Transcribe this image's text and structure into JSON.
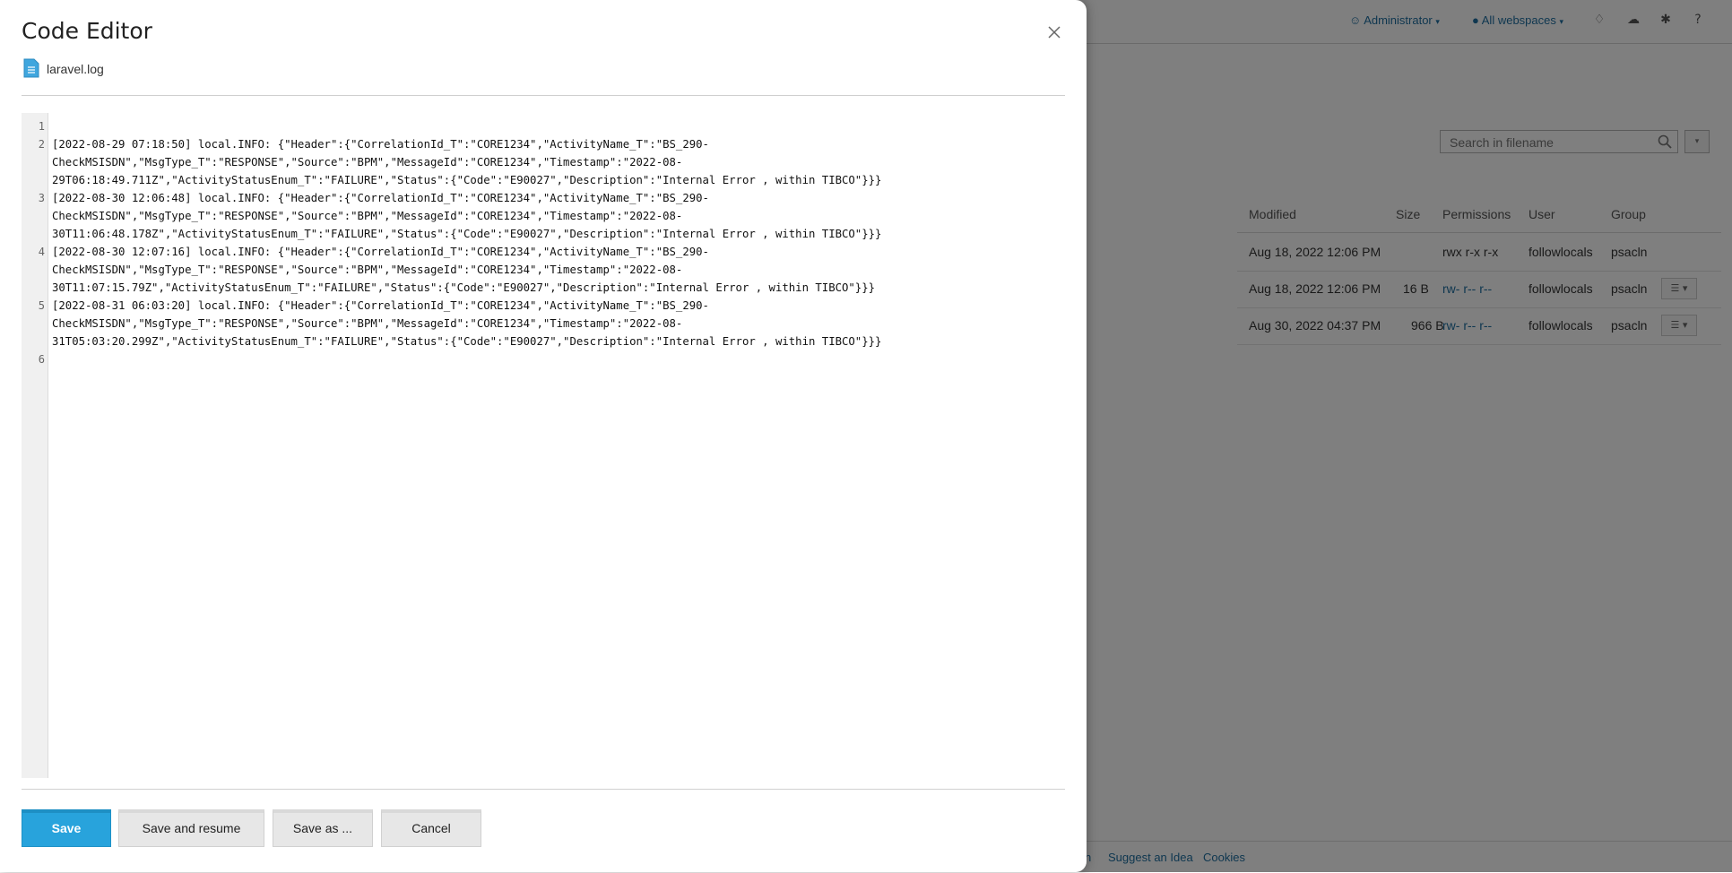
{
  "background": {
    "topbar": {
      "user_label": "Administrator",
      "webspaces_label": "All webspaces",
      "icons": [
        "bell-icon",
        "cloud-icon",
        "puzzle-icon",
        "help-icon"
      ]
    },
    "search": {
      "placeholder": "Search in filename"
    },
    "table": {
      "columns": [
        "Modified",
        "Size",
        "Permissions",
        "User",
        "Group"
      ],
      "rows": [
        {
          "modified": "Aug 18, 2022 12:06 PM",
          "size": "",
          "permissions": "rwx r-x r-x",
          "user": "followlocals",
          "group": "psacln"
        },
        {
          "modified": "Aug 18, 2022 12:06 PM",
          "size": "16 B",
          "permissions": "rw- r-- r--",
          "user": "followlocals",
          "group": "psacln"
        },
        {
          "modified": "Aug 30, 2022 04:37 PM",
          "size": "966 B",
          "permissions": "rw- r-- r--",
          "user": "followlocals",
          "group": "psacln"
        }
      ]
    },
    "footer": {
      "links": [
        "n",
        "Suggest an Idea",
        "Cookies"
      ]
    }
  },
  "modal": {
    "title": "Code Editor",
    "file_name": "laravel.log",
    "editor": {
      "line_numbers": [
        "1",
        "2",
        "3",
        "4",
        "5",
        "6"
      ],
      "wrapped_lines": [
        "[2022-08-29 07:18:50] local.INFO: {\"Header\":{\"CorrelationId_T\":\"CORE1234\",\"ActivityName_T\":\"BS_290-",
        "CheckMSISDN\",\"MsgType_T\":\"RESPONSE\",\"Source\":\"BPM\",\"MessageId\":\"CORE1234\",\"Timestamp\":\"2022-08-",
        "29T06:18:49.711Z\",\"ActivityStatusEnum_T\":\"FAILURE\",\"Status\":{\"Code\":\"E90027\",\"Description\":\"Internal Error , within TIBCO\"}}}",
        "[2022-08-30 12:06:48] local.INFO: {\"Header\":{\"CorrelationId_T\":\"CORE1234\",\"ActivityName_T\":\"BS_290-",
        "CheckMSISDN\",\"MsgType_T\":\"RESPONSE\",\"Source\":\"BPM\",\"MessageId\":\"CORE1234\",\"Timestamp\":\"2022-08-",
        "30T11:06:48.178Z\",\"ActivityStatusEnum_T\":\"FAILURE\",\"Status\":{\"Code\":\"E90027\",\"Description\":\"Internal Error , within TIBCO\"}}}",
        "[2022-08-30 12:07:16] local.INFO: {\"Header\":{\"CorrelationId_T\":\"CORE1234\",\"ActivityName_T\":\"BS_290-",
        "CheckMSISDN\",\"MsgType_T\":\"RESPONSE\",\"Source\":\"BPM\",\"MessageId\":\"CORE1234\",\"Timestamp\":\"2022-08-",
        "30T11:07:15.79Z\",\"ActivityStatusEnum_T\":\"FAILURE\",\"Status\":{\"Code\":\"E90027\",\"Description\":\"Internal Error , within TIBCO\"}}}",
        "[2022-08-31 06:03:20] local.INFO: {\"Header\":{\"CorrelationId_T\":\"CORE1234\",\"ActivityName_T\":\"BS_290-",
        "CheckMSISDN\",\"MsgType_T\":\"RESPONSE\",\"Source\":\"BPM\",\"MessageId\":\"CORE1234\",\"Timestamp\":\"2022-08-",
        "31T05:03:20.299Z\",\"ActivityStatusEnum_T\":\"FAILURE\",\"Status\":{\"Code\":\"E90027\",\"Description\":\"Internal Error , within TIBCO\"}}}"
      ]
    },
    "buttons": {
      "save": "Save",
      "save_resume": "Save and resume",
      "save_as": "Save as ...",
      "cancel": "Cancel"
    }
  },
  "colors": {
    "primary": "#28a3dc",
    "link": "#1f6fa0"
  }
}
